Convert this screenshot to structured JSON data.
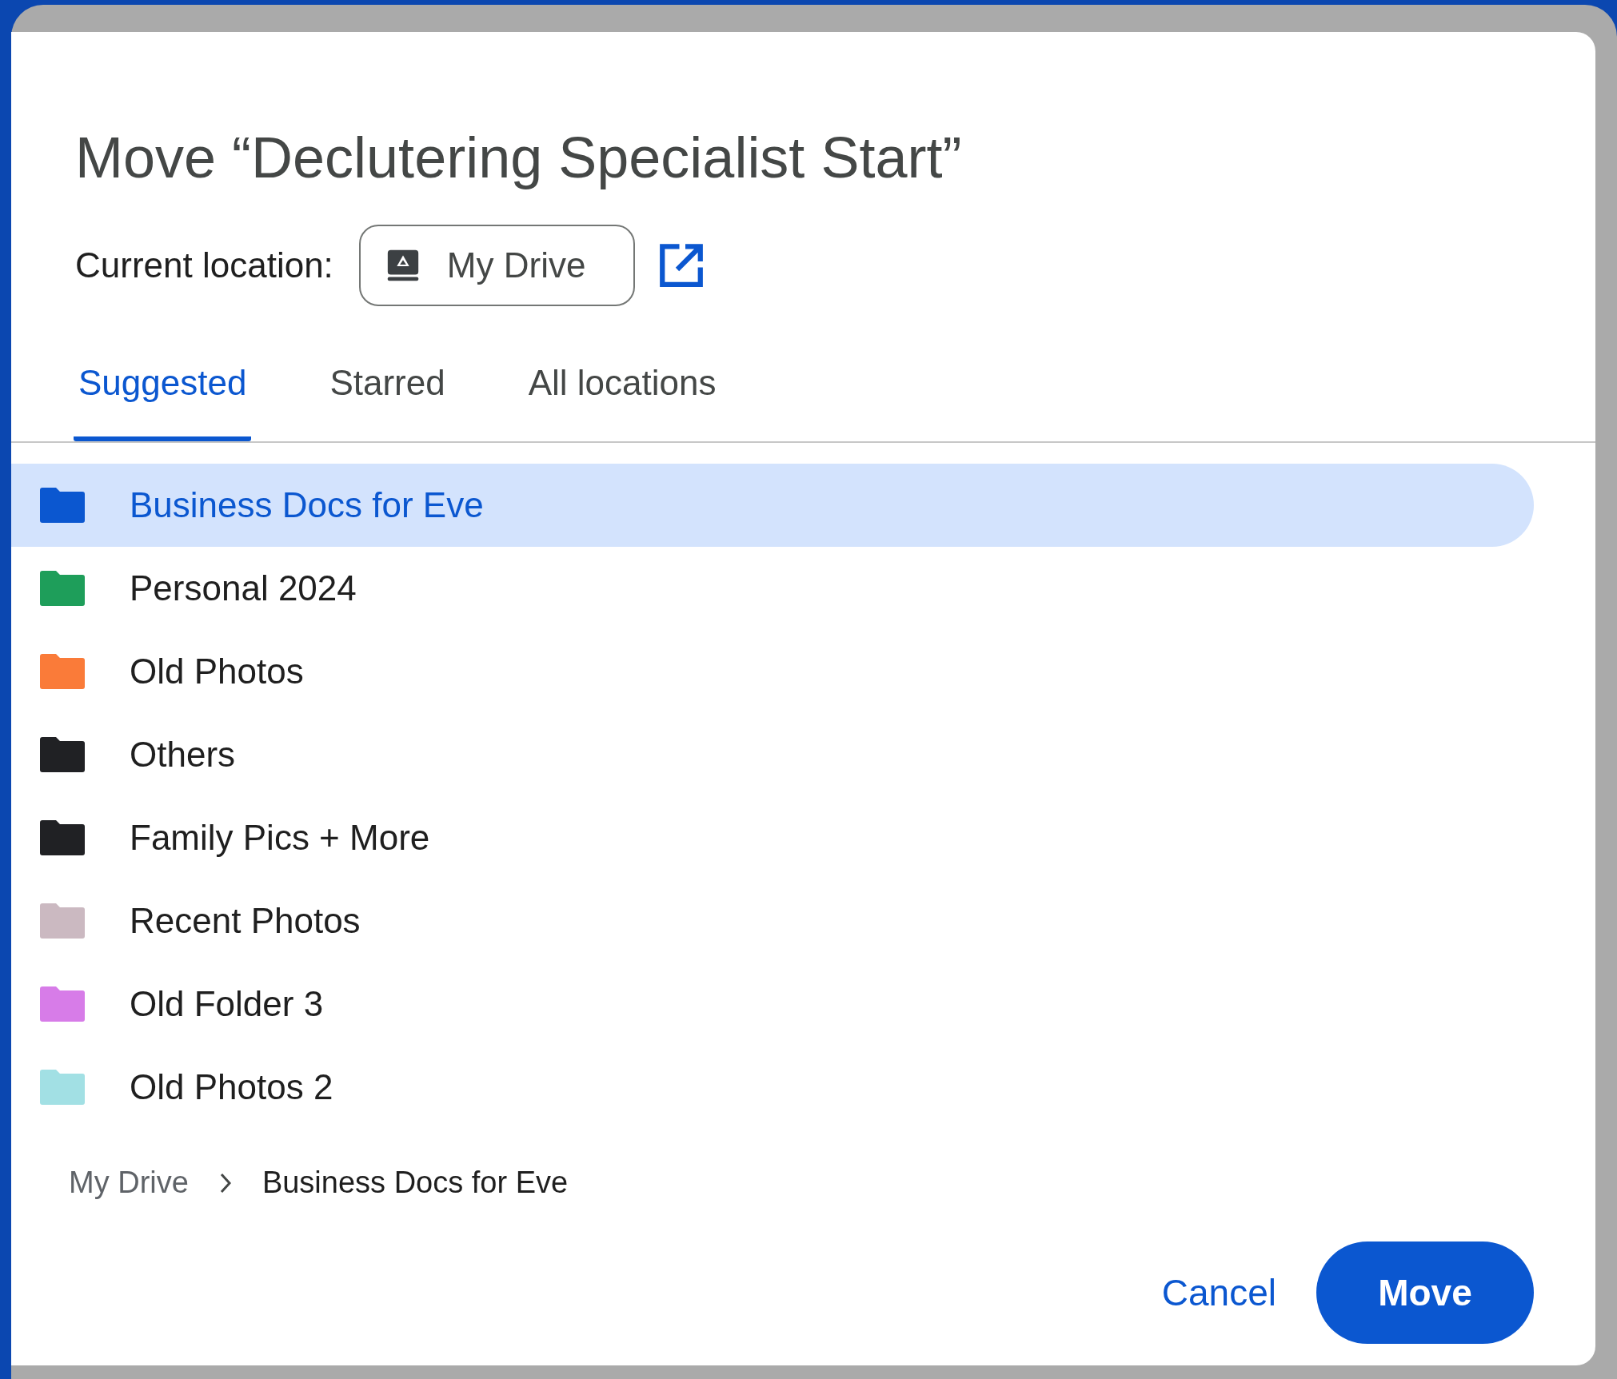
{
  "dialog": {
    "title": "Move “Declutering Specialist Start”"
  },
  "current_location": {
    "label": "Current location:",
    "value": "My Drive"
  },
  "tabs": [
    {
      "label": "Suggested",
      "selected": true
    },
    {
      "label": "Starred",
      "selected": false
    },
    {
      "label": "All locations",
      "selected": false
    }
  ],
  "folders": [
    {
      "name": "Business Docs for Eve",
      "color": "#0b57d0",
      "selected": true
    },
    {
      "name": "Personal 2024",
      "color": "#1e9e5a",
      "selected": false
    },
    {
      "name": "Old Photos",
      "color": "#fa7b39",
      "selected": false
    },
    {
      "name": "Others",
      "color": "#202124",
      "selected": false
    },
    {
      "name": "Family Pics + More",
      "color": "#202124",
      "selected": false
    },
    {
      "name": "Recent Photos",
      "color": "#cbb9c1",
      "selected": false
    },
    {
      "name": "Old Folder 3",
      "color": "#d77ce8",
      "selected": false
    },
    {
      "name": "Old Photos 2",
      "color": "#a2e0e4",
      "selected": false
    }
  ],
  "breadcrumb": [
    "My Drive",
    "Business Docs for Eve"
  ],
  "buttons": {
    "cancel": "Cancel",
    "move": "Move"
  }
}
